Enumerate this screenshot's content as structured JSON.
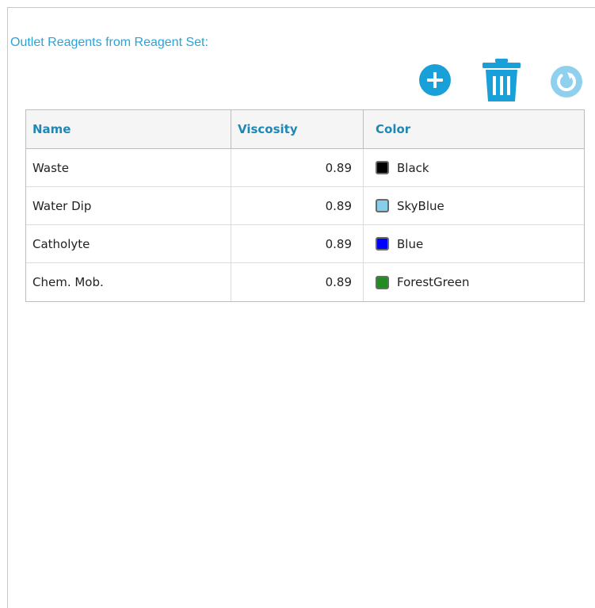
{
  "section": {
    "title": "Outlet Reagents from Reagent Set:"
  },
  "toolbar": {
    "add_icon": "plus-circle-icon",
    "delete_icon": "trash-icon",
    "refresh_icon": "refresh-icon",
    "accent_color": "#1aa0d8",
    "disabled_color": "#8fd0ee"
  },
  "table": {
    "columns": [
      "Name",
      "Viscosity",
      "Color"
    ],
    "rows": [
      {
        "name": "Waste",
        "viscosity": "0.89",
        "color_name": "Black",
        "color_hex": "#000000"
      },
      {
        "name": "Water Dip",
        "viscosity": "0.89",
        "color_name": "SkyBlue",
        "color_hex": "#87ceeb"
      },
      {
        "name": "Catholyte",
        "viscosity": "0.89",
        "color_name": "Blue",
        "color_hex": "#0000ff"
      },
      {
        "name": "Chem. Mob.",
        "viscosity": "0.89",
        "color_name": "ForestGreen",
        "color_hex": "#228b22"
      }
    ]
  }
}
